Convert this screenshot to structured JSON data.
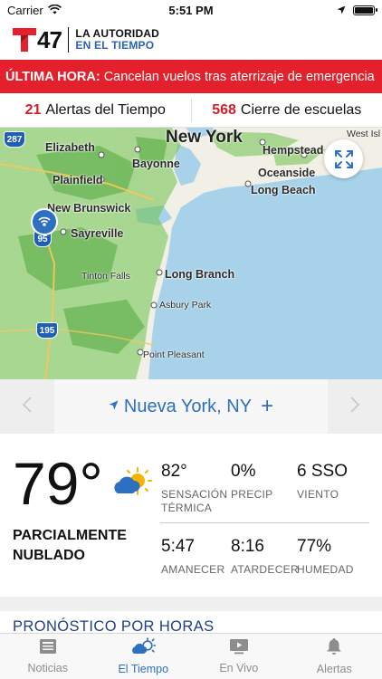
{
  "status_bar": {
    "carrier": "Carrier",
    "time": "5:51 PM"
  },
  "header": {
    "logo_number": "47",
    "tagline_line1": "LA AUTORIDAD",
    "tagline_line2": "EN EL TIEMPO"
  },
  "breaking": {
    "tag": "ÚLTIMA HORA:",
    "text": "Cancelan vuelos tras aterrizaje de emergencia"
  },
  "alerts": {
    "weather_count": "21",
    "weather_label": "Alertas del Tiempo",
    "schools_count": "568",
    "schools_label": "Cierre de escuelas"
  },
  "map": {
    "labels": {
      "new_york": "New York",
      "elizabeth": "Elizabeth",
      "bayonne": "Bayonne",
      "plainfield": "Plainfield",
      "new_brunswick": "New Brunswick",
      "sayreville": "Sayreville",
      "hempstead": "Hempstead",
      "west_islip": "West Isl",
      "oceanside": "Oceanside",
      "long_beach": "Long Beach",
      "tinton_falls": "Tinton Falls",
      "long_branch": "Long Branch",
      "asbury_park": "Asbury Park",
      "point_pleasant": "Point Pleasant",
      "shield_287": "287",
      "shield_95": "95",
      "shield_195": "195"
    }
  },
  "location": {
    "name": "Nueva York, NY",
    "add": "+"
  },
  "current": {
    "temperature": "79°",
    "condition_line1": "PARCIALMENTE",
    "condition_line2": "NUBLADO",
    "stats": {
      "feels_like": {
        "value": "82°",
        "label_line1": "SENSACIÓN",
        "label_line2": "TÉRMICA"
      },
      "precip": {
        "value": "0%",
        "label": "PRECIP"
      },
      "wind": {
        "value": "6 SSO",
        "label": "VIENTO"
      },
      "sunrise": {
        "value": "5:47",
        "label": "AMANECER"
      },
      "sunset": {
        "value": "8:16",
        "label": "ATARDECER"
      },
      "humidity": {
        "value": "77%",
        "label": "HUMEDAD"
      }
    }
  },
  "hourly": {
    "title": "PRONÓSTICO POR HORAS"
  },
  "tabs": [
    {
      "label": "Noticias",
      "icon": "news-icon"
    },
    {
      "label": "El Tiempo",
      "icon": "weather-icon"
    },
    {
      "label": "En Vivo",
      "icon": "live-video-icon"
    },
    {
      "label": "Alertas",
      "icon": "bell-icon"
    }
  ],
  "colors": {
    "accent": "#2d6fc1",
    "brand_red": "#e3202b",
    "alert_red": "#d31f2a"
  }
}
